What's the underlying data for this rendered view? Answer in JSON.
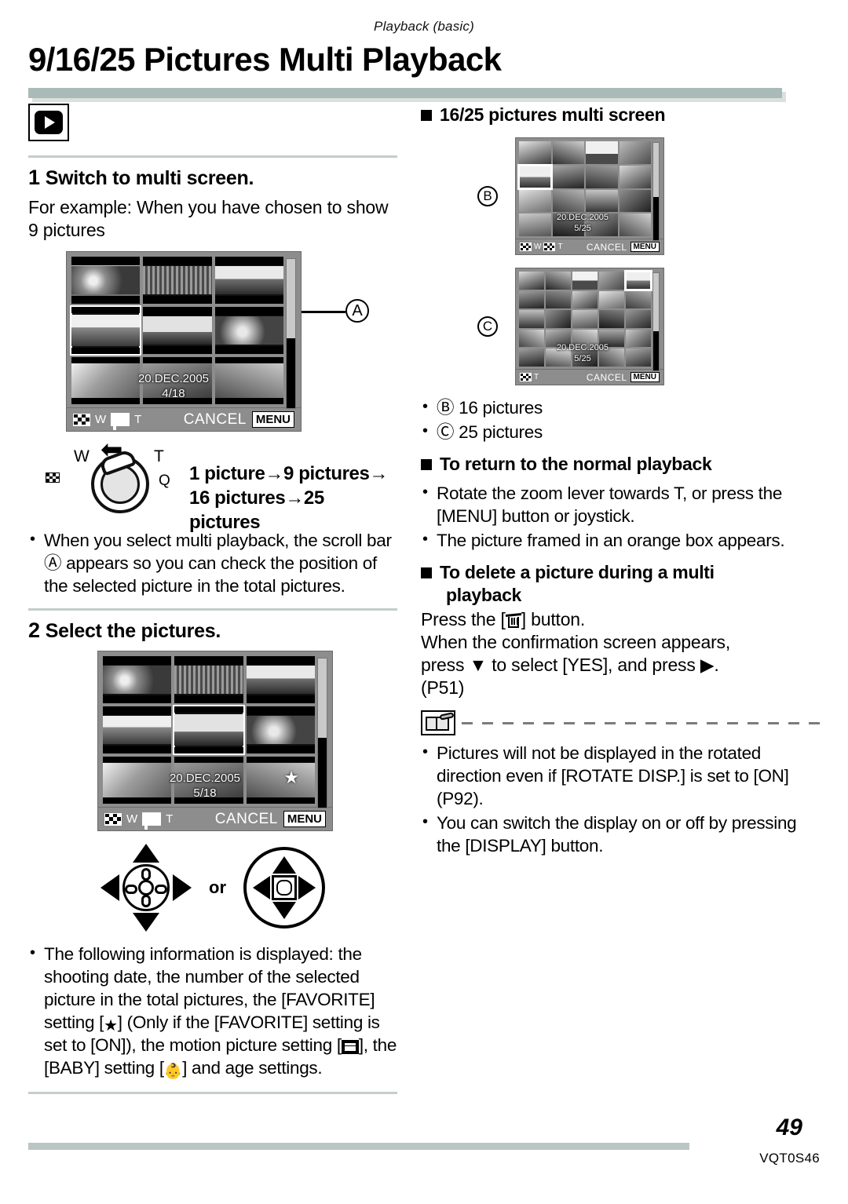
{
  "header": {
    "running_head": "Playback (basic)",
    "title": "9/16/25 Pictures Multi Playback"
  },
  "left_column": {
    "mode_icon_name": "playback-mode-icon",
    "step1": {
      "number": "1",
      "heading": "Switch to multi screen.",
      "intro": "For example: When you have chosen to show 9 pictures"
    },
    "screen_9": {
      "osd_date": "20.DEC.2005",
      "osd_count": "4/18",
      "bar": {
        "w_label": "W",
        "t_label": "T",
        "cancel": "CANCEL",
        "menu": "MENU"
      },
      "callout": "A"
    },
    "zoom_lever": {
      "w_label": "W",
      "t_label": "T",
      "q_label": "Q",
      "line1": "1 picture→9 pictures→",
      "line2": "16 pictures→25 pictures"
    },
    "note_scrollbar": "When you select multi playback, the scroll bar Ⓐ appears so you can check the position of the selected picture in the total pictures.",
    "step2": {
      "number": "2",
      "heading": "Select the pictures."
    },
    "screen_9_sel": {
      "osd_date": "20.DEC.2005",
      "osd_count": "5/18",
      "favorite_star": "★",
      "bar": {
        "w_label": "W",
        "t_label": "T",
        "cancel": "CANCEL",
        "menu": "MENU"
      }
    },
    "controls": {
      "or_label": "or"
    },
    "info_note": {
      "part1": "The following information is displayed: the shooting date, the number of the selected picture in the total pictures, the [FAVORITE] setting [",
      "part2": "] (Only if the [FAVORITE] setting is set to [ON]), the motion picture setting [",
      "part3": "], the [BABY] setting [",
      "part4": "] and age settings."
    }
  },
  "right_column": {
    "section1_heading": "16/25 pictures multi screen",
    "screen_16": {
      "callout": "B",
      "osd_date": "20.DEC.2005",
      "osd_count": "5/25",
      "bar": {
        "w_label": "W",
        "t_label": "T",
        "cancel": "CANCEL",
        "menu": "MENU"
      }
    },
    "screen_25": {
      "callout": "C",
      "osd_date": "20.DEC.2005",
      "osd_count": "5/25",
      "bar": {
        "t_label": "T",
        "cancel": "CANCEL",
        "menu": "MENU"
      }
    },
    "bullets": [
      {
        "callout": "Ⓑ",
        "text": "16 pictures"
      },
      {
        "callout": "Ⓒ",
        "text": "25 pictures"
      }
    ],
    "section2_heading": "To return to the normal playback",
    "section2_bullets": [
      "Rotate the zoom lever towards T, or press the [MENU] button or joystick.",
      "The picture framed in an orange box appears."
    ],
    "section3_heading_line1": "To delete a picture during a multi",
    "section3_heading_line2": "playback",
    "delete_text": {
      "press_prefix": "Press the [",
      "press_suffix": "] button.",
      "line2": "When the confirmation screen appears,",
      "line3_a": "press ",
      "line3_down": "▼",
      "line3_b": " to select [YES], and press ",
      "line3_right": "▶",
      "line3_c": ".",
      "line4": "(P51)"
    },
    "note_bullets": [
      "Pictures will not be displayed in the rotated direction even if [ROTATE DISP.] is set to [ON] (P92).",
      "You can switch the display on or off by pressing the [DISPLAY] button."
    ]
  },
  "footer": {
    "page_number": "49",
    "doc_code": "VQT0S46"
  }
}
